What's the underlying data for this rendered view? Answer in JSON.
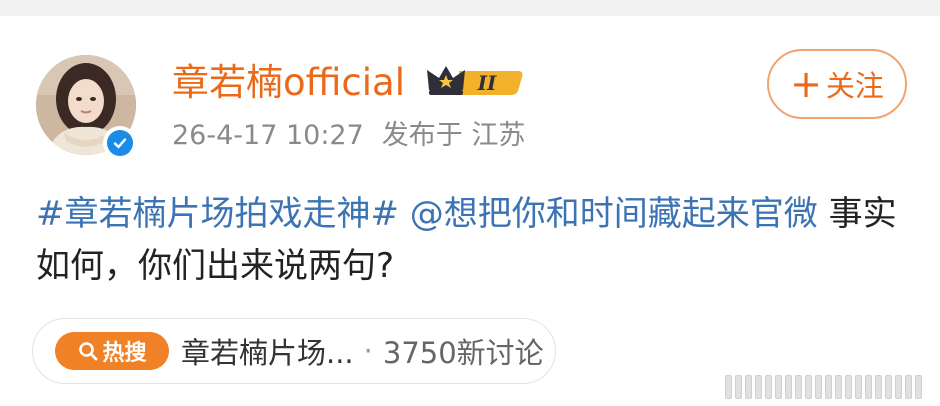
{
  "post": {
    "username": "章若楠official",
    "vip_level": "II",
    "timestamp": "26-4-17 10:27",
    "location": "发布于 江苏",
    "follow_label": "关注",
    "content": {
      "topic": "#章若楠片场拍戏走神#",
      "mention": "@想把你和时间藏起来官微",
      "text": "事实如何，你们出来说两句?"
    },
    "hot_search": {
      "badge": "热搜",
      "title": "章若楠片场...",
      "separator": "·",
      "count": "3750新讨论"
    }
  },
  "colors": {
    "username": "#ea6a1a",
    "link": "#3c73b4",
    "hot_badge": "#f08126",
    "verified": "#1b8be8"
  },
  "icons": [
    "avatar-photo",
    "verified-icon",
    "crown-icon",
    "plus-icon",
    "search-icon"
  ]
}
